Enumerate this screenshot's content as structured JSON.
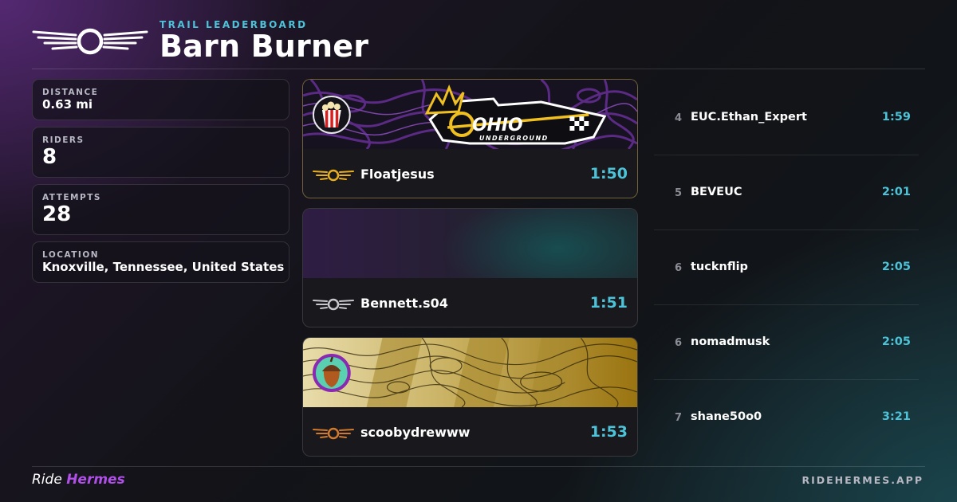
{
  "header": {
    "eyebrow": "TRAIL LEADERBOARD",
    "title": "Barn Burner",
    "logo_icon": "hermes-winged-wheel-logo"
  },
  "stats": [
    {
      "label": "DISTANCE",
      "value": "0.63 mi"
    },
    {
      "label": "RIDERS",
      "value": "8"
    },
    {
      "label": "ATTEMPTS",
      "value": "28"
    },
    {
      "label": "LOCATION",
      "value": "Knoxville, Tennessee, United States"
    }
  ],
  "podium": [
    {
      "rank": 1,
      "medal": "gold",
      "medal_color": "#e8b020",
      "name": "Floatjesus",
      "time": "1:50",
      "banner": {
        "logo_text": "OHIO",
        "logo_subtext": "UNDERGROUND",
        "avatar_icon": "popcorn-icon"
      }
    },
    {
      "rank": 2,
      "medal": "silver",
      "medal_color": "#c8c8cc",
      "name": "Bennett.s04",
      "time": "1:51"
    },
    {
      "rank": 3,
      "medal": "bronze",
      "medal_color": "#d07a30",
      "name": "scoobydrewww",
      "time": "1:53",
      "banner": {
        "avatar_icon": "acorn-icon"
      }
    }
  ],
  "leaderboard": [
    {
      "rank": "4",
      "name": "EUC.Ethan_Expert",
      "time": "1:59"
    },
    {
      "rank": "5",
      "name": "BEVEUC",
      "time": "2:01"
    },
    {
      "rank": "6",
      "name": "tucknflip",
      "time": "2:05"
    },
    {
      "rank": "6",
      "name": "nomadmusk",
      "time": "2:05"
    },
    {
      "rank": "7",
      "name": "shane50o0",
      "time": "3:21"
    }
  ],
  "footer": {
    "ride": "Ride",
    "brand": "Hermes",
    "url": "RIDEHERMES.APP"
  },
  "colors": {
    "accent_cyan": "#4cc3d8",
    "brand_purple": "#b050e8"
  }
}
